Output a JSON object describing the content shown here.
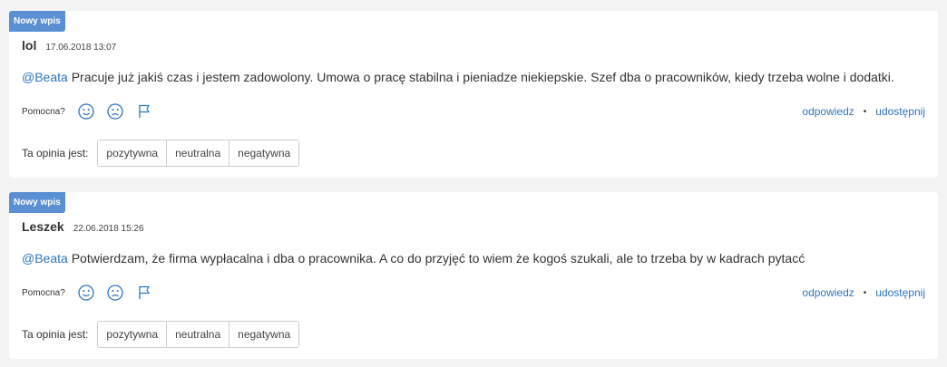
{
  "reviews": [
    {
      "badge": "Nowy wpis",
      "author": "lol",
      "date": "17.06.2018 13:07",
      "mention": "@Beata",
      "text": " Pracuje już jakiś czas i jestem zadowolony. Umowa o pracę stabilna i pieniadze niekiepskie. Szef dba o pracowników, kiedy trzeba wolne i dodatki.",
      "helpful_label": "Pomocna?",
      "reply": "odpowiedz",
      "share": "udostępnij",
      "separator": "•",
      "rating_label": "Ta opinia jest:",
      "options": [
        "pozytywna",
        "neutralna",
        "negatywna"
      ]
    },
    {
      "badge": "Nowy wpis",
      "author": "Leszek",
      "date": "22.06.2018 15:26",
      "mention": "@Beata",
      "text": " Potwierdzam, że firma wypłacalna i dba o pracownika. A co do przyjęć to wiem że kogoś szukali, ale to trzeba by w kadrach pytacć",
      "helpful_label": "Pomocna?",
      "reply": "odpowiedz",
      "share": "udostępnij",
      "separator": "•",
      "rating_label": "Ta opinia jest:",
      "options": [
        "pozytywna",
        "neutralna",
        "negatywna"
      ]
    }
  ],
  "icons": {
    "happy": "smile-face-icon",
    "sad": "sad-face-icon",
    "flag": "flag-icon"
  },
  "colors": {
    "badge": "#5a8fd4",
    "link": "#2f74c0"
  }
}
